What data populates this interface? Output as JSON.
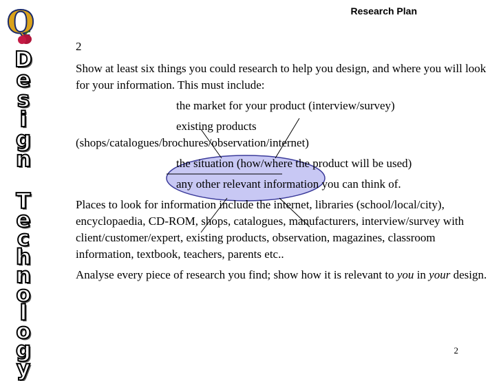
{
  "header": {
    "title": "Research Plan"
  },
  "sidebar": {
    "word1": [
      "D",
      "e",
      "s",
      "i",
      "g",
      "n"
    ],
    "word2": [
      "T",
      "e",
      "c",
      "h",
      "n",
      "o",
      "l",
      "o",
      "g",
      "y"
    ]
  },
  "logo": {
    "letter": "Q",
    "icon": "q-apple-logo-icon"
  },
  "content": {
    "number": "2",
    "intro": "Show at least six things you could research to help you design, and where you will look for your information.  This must include:",
    "items": [
      "the market for your product (interview/survey)",
      "existing products",
      "(shops/catalogues/brochures/observation/internet)",
      "the situation (how/where the product will be used)",
      "any other relevant information you can think of."
    ],
    "places": "Places to look for information include the internet, libraries (school/local/city), encyclopaedia, CD-ROM, shops, catalogues, manufacturers, interview/survey with client/customer/expert, existing products, observation, magazines, classroom information, textbook, teachers, parents etc..",
    "analyse_pre": "Analyse every piece of research you find; show how it is relevant to ",
    "analyse_you": "you",
    "analyse_in": " in ",
    "analyse_your": "your",
    "analyse_post": " design."
  },
  "footer": {
    "page_number": "2"
  },
  "colors": {
    "ellipse_fill": "#c8c8f4",
    "ellipse_stroke": "#3a3a9a",
    "logo_q": "#d9a21b",
    "logo_apple": "#b0143a"
  }
}
